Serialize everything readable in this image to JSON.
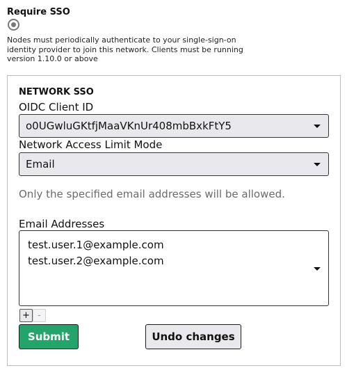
{
  "sso": {
    "title": "Require SSO",
    "checked": true,
    "description": "Nodes must periodically authenticate to your single-sign-on identity provider to join this network. Clients must be running version 1.10.0 or above"
  },
  "network_sso": {
    "section_title": "NETWORK SSO",
    "client_id_label": "OIDC Client ID",
    "client_id_value": "o0UGwluGKtfjMaaVKnUr408mbBxkFtY5",
    "limit_mode_label": "Network Access Limit Mode",
    "limit_mode_value": "Email",
    "help_text": "Only the specified email addresses will be allowed.",
    "emails_label": "Email Addresses",
    "emails": [
      "test.user.1@example.com",
      "test.user.2@example.com"
    ],
    "add_label": "+",
    "remove_label": "-"
  },
  "actions": {
    "submit_label": "Submit",
    "undo_label": "Undo changes"
  },
  "colors": {
    "submit_bg": "#24a36b",
    "select_bg": "#e9e9ed"
  },
  "icons": {
    "dropdown": "chevron-down-icon",
    "radio": "radio-selected-icon"
  }
}
